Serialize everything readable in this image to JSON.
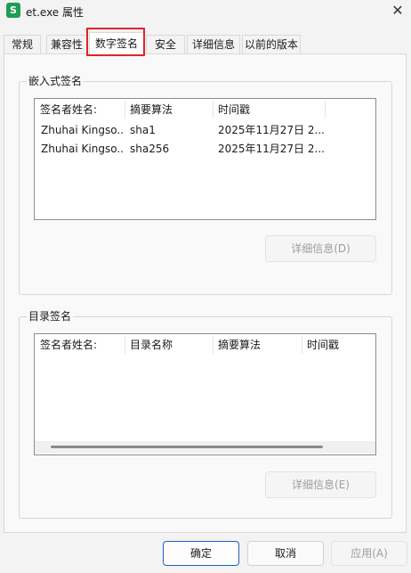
{
  "window": {
    "title": "et.exe 属性",
    "app_icon_letter": "S",
    "close_glyph": "✕"
  },
  "tabs": [
    {
      "label": "常规"
    },
    {
      "label": "兼容性"
    },
    {
      "label": "数字签名",
      "active": true
    },
    {
      "label": "安全"
    },
    {
      "label": "详细信息"
    },
    {
      "label": "以前的版本"
    }
  ],
  "embedded": {
    "group_label": "嵌入式签名",
    "columns": [
      "签名者姓名:",
      "摘要算法",
      "时间戳"
    ],
    "rows": [
      [
        "Zhuhai Kingso...",
        "sha1",
        "2025年11月27日 2..."
      ],
      [
        "Zhuhai Kingso...",
        "sha256",
        "2025年11月27日 2..."
      ]
    ],
    "details_button": "详细信息(D)"
  },
  "catalog": {
    "group_label": "目录签名",
    "columns": [
      "签名者姓名:",
      "目录名称",
      "摘要算法",
      "时间戳"
    ],
    "details_button": "详细信息(E)"
  },
  "footer": {
    "ok": "确定",
    "cancel": "取消",
    "apply": "应用(A)"
  },
  "colors": {
    "highlight_box": "#e0242b",
    "primary_border": "#1f5fbf",
    "app_icon": "#1f9d55"
  }
}
